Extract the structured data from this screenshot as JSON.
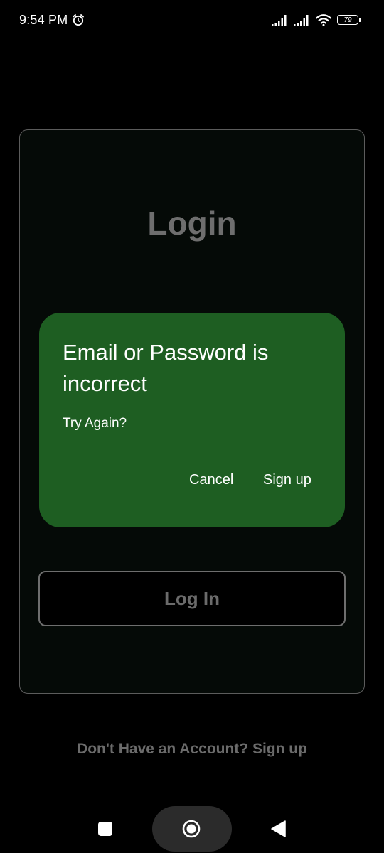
{
  "status_bar": {
    "time": "9:54 PM",
    "battery_level": "79",
    "icons": [
      "alarm-icon",
      "signal-icon",
      "signal-icon",
      "wifi-icon",
      "battery-icon"
    ]
  },
  "login": {
    "title": "Login",
    "login_button_label": "Log In"
  },
  "dialog": {
    "title": "Email or Password is incorrect",
    "message": "Try Again?",
    "cancel_label": "Cancel",
    "signup_label": "Sign up"
  },
  "footer": {
    "signup_prompt": "Don't Have an Account? Sign up"
  },
  "nav_bar": {
    "icons": [
      "recents-square-icon",
      "home-circle-icon",
      "back-triangle-icon"
    ]
  },
  "colors": {
    "background": "#000000",
    "dialog_background": "#1e5e22",
    "muted_text": "#6e6e6e"
  }
}
